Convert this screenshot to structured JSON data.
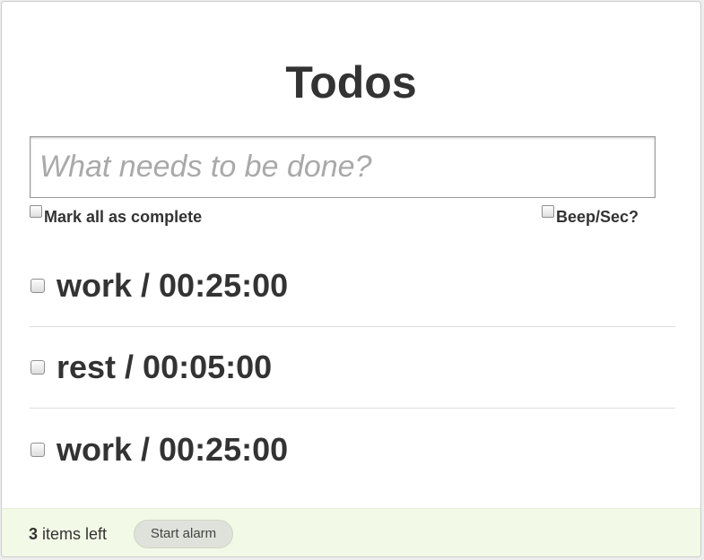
{
  "header": {
    "title": "Todos"
  },
  "new_todo": {
    "placeholder": "What needs to be done?",
    "value": ""
  },
  "controls": {
    "mark_all_label": "Mark all as complete",
    "mark_all_checked": false,
    "beep_label": "Beep/Sec?",
    "beep_checked": false
  },
  "todos": [
    {
      "text": "work / 00:25:00",
      "done": false
    },
    {
      "text": "rest / 00:05:00",
      "done": false
    },
    {
      "text": "work / 00:25:00",
      "done": false
    }
  ],
  "footer": {
    "count": "3",
    "count_suffix": "items left",
    "start_alarm_label": "Start alarm"
  },
  "colors": {
    "text": "#333333",
    "footer_bg": "#f3f9e7",
    "button_bg": "#dfe2da",
    "placeholder": "#a9a9a9"
  }
}
